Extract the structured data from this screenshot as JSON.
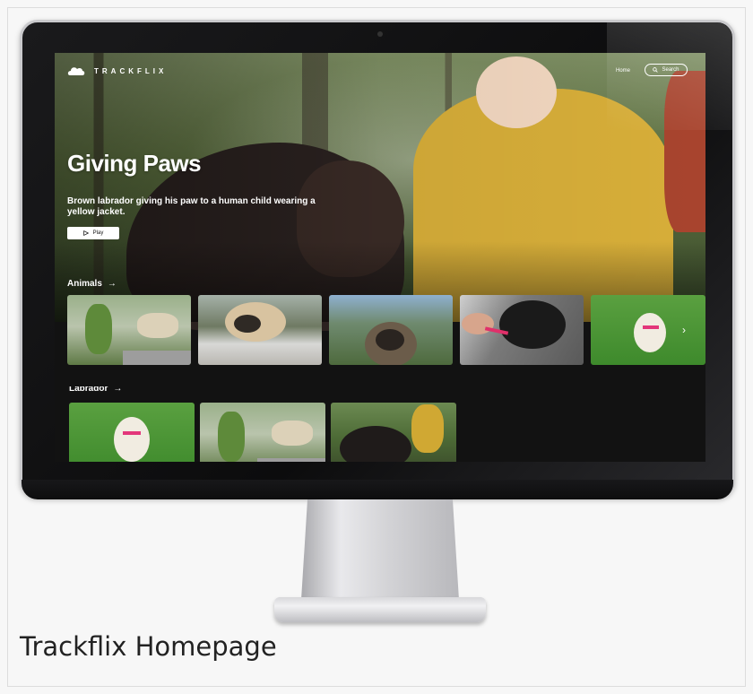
{
  "app": {
    "brand": "TRACKFLIX"
  },
  "nav": {
    "home_label": "Home",
    "search_label": "Search"
  },
  "hero": {
    "title": "Giving Paws",
    "description": "Brown labrador giving his paw to a human child wearing a yellow jacket.",
    "play_label": "Play"
  },
  "rows": [
    {
      "title": "Animals",
      "items": [
        "garden-dog",
        "pug-on-table",
        "pug-in-forest",
        "black-pug-with-leash",
        "puppy-on-grass"
      ]
    },
    {
      "title": "Labrador",
      "items": [
        "puppy-on-grass",
        "garden-dog",
        "labrador-with-child"
      ]
    }
  ],
  "caption": "Trackflix Homepage",
  "colors": {
    "page_bg": "#f7f7f7",
    "screen_bg": "#121212",
    "accent": "#ffffff"
  }
}
